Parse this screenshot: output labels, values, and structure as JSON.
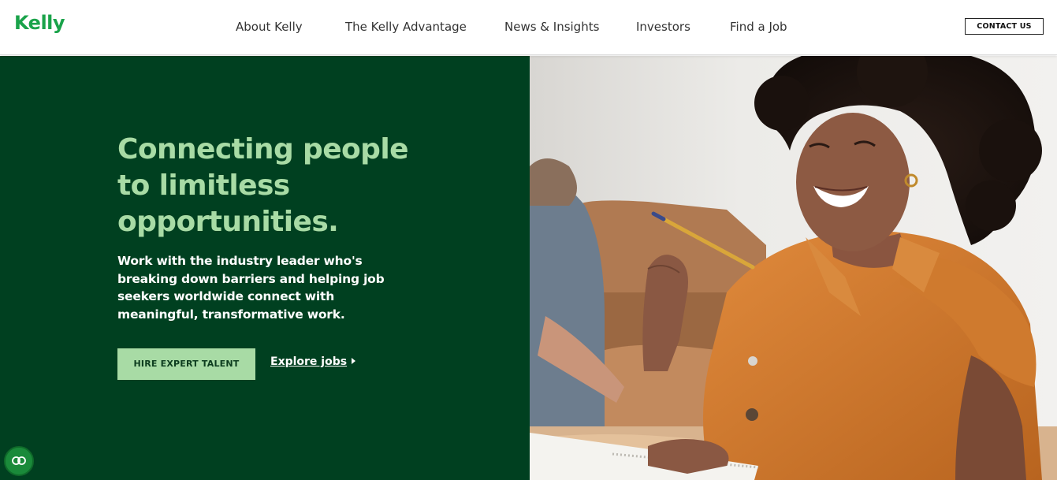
{
  "header": {
    "logo": "Kelly",
    "nav": [
      {
        "label": "About Kelly"
      },
      {
        "label": "The Kelly Advantage"
      },
      {
        "label": "News & Insights"
      },
      {
        "label": "Investors"
      },
      {
        "label": "Find a Job"
      }
    ],
    "contact_label": "CONTACT US"
  },
  "hero": {
    "headline": "Connecting people to limitless opportunities.",
    "subtext": "Work with the industry leader who's breaking down barriers and helping job seekers worldwide connect with meaningful, transformative work.",
    "primary_cta": "HIRE EXPERT TALENT",
    "secondary_cta": "Explore jobs"
  },
  "colors": {
    "brand_green": "#1aa34a",
    "hero_dark_green": "#004020",
    "accent_light_green": "#a8dba5"
  },
  "icons": {
    "chat": "chat-bubble-icon",
    "explore_caret": "caret-right-icon"
  }
}
